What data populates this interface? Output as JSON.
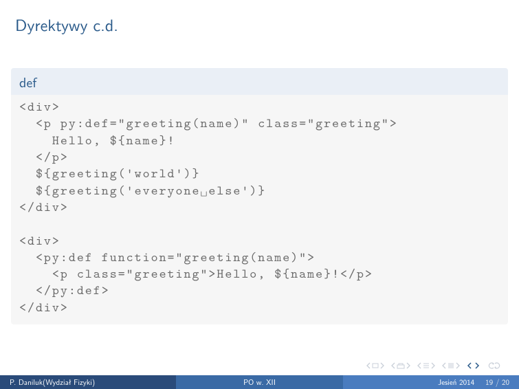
{
  "title": "Dyrektywy c.d.",
  "block": {
    "header": "def",
    "code": "<div>\n  <p py:def=\"greeting(name)\" class=\"greeting\">\n    Hello, ${name}!\n  </p>\n  ${greeting('world')}\n  ${greeting('everyone␣else')}\n</div>\n\n<div>\n  <py:def function=\"greeting(name)\">\n    <p class=\"greeting\">Hello, ${name}!</p>\n  </py:def>\n</div>"
  },
  "footer": {
    "author": "P. Daniluk(Wydział Fizyki)",
    "center": "PO w. XII",
    "term": "Jesień 2014",
    "page": "19 / 20"
  }
}
